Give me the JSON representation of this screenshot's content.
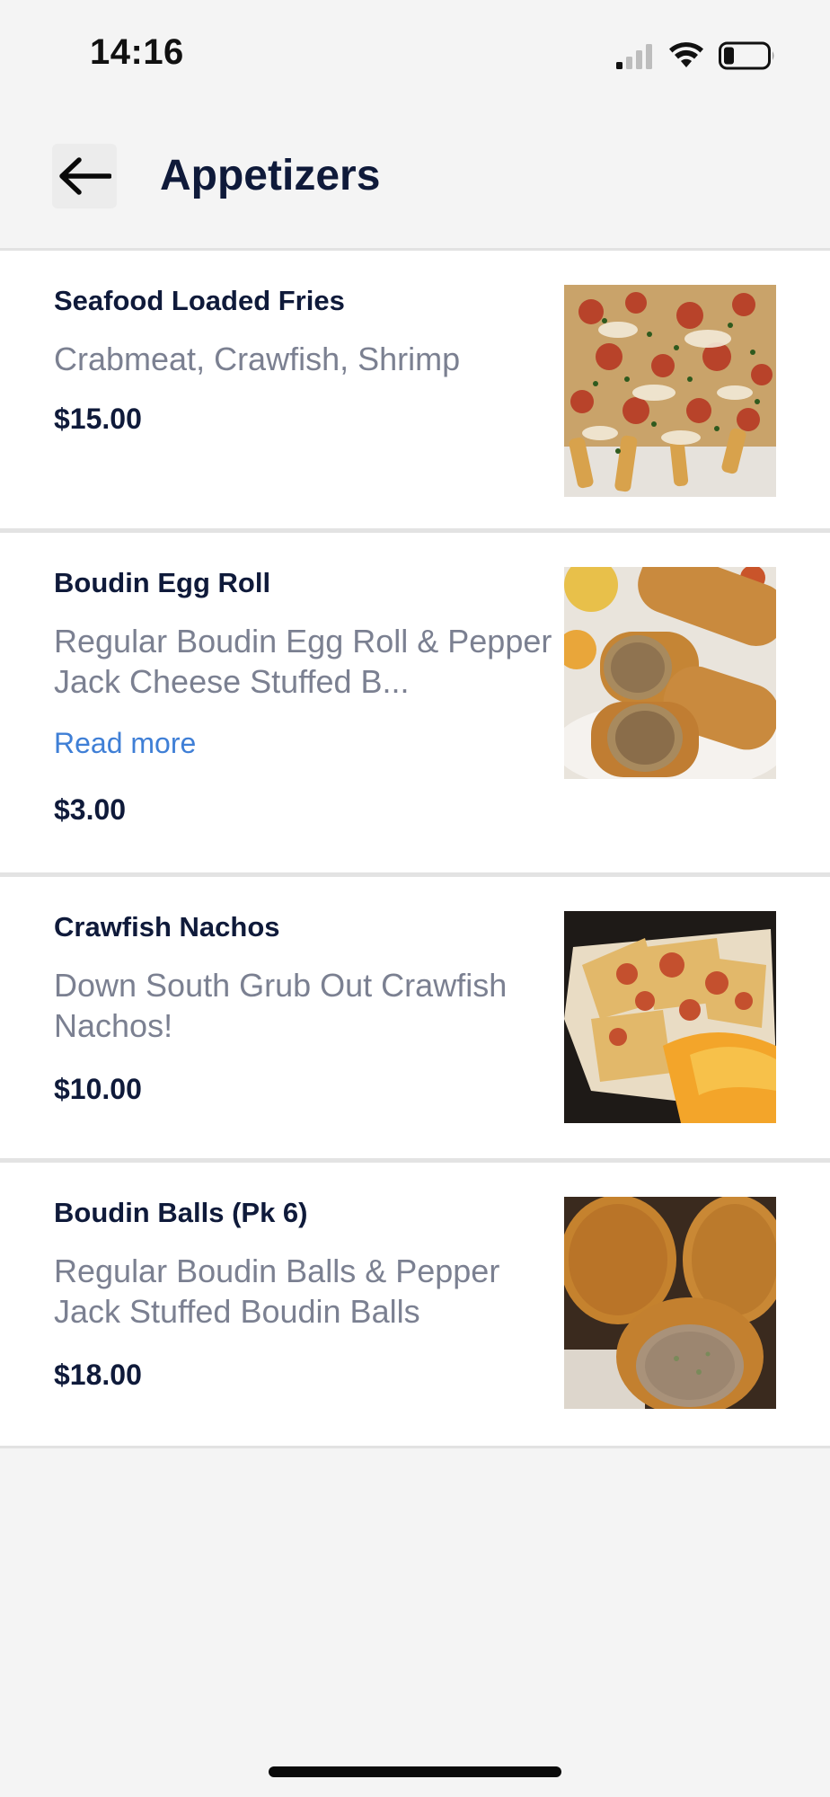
{
  "status_bar": {
    "time": "14:16",
    "icons": [
      "cellular-signal-icon",
      "wifi-icon",
      "battery-icon"
    ]
  },
  "header": {
    "back_icon": "arrow-left-icon",
    "title": "Appetizers"
  },
  "items": [
    {
      "name": "Seafood Loaded Fries",
      "description": "Crabmeat, Crawfish, Shrimp",
      "price": "$15.00",
      "image": "seafood-loaded-fries-photo"
    },
    {
      "name": "Boudin Egg Roll",
      "description": "Regular Boudin Egg Roll & Pepper Jack Cheese Stuffed B...",
      "read_more": "Read more",
      "price": "$3.00",
      "image": "boudin-egg-roll-photo"
    },
    {
      "name": "Crawfish Nachos",
      "description": "Down South Grub Out Crawfish Nachos!",
      "price": "$10.00",
      "image": "crawfish-nachos-photo"
    },
    {
      "name": "Boudin Balls (Pk 6)",
      "description": "Regular Boudin Balls & Pepper Jack Stuffed Boudin Balls",
      "price": "$18.00",
      "image": "boudin-balls-photo"
    }
  ],
  "colors": {
    "background": "#f4f4f4",
    "card": "#ffffff",
    "title": "#0f1a3a",
    "description": "#7b8091",
    "link": "#3f7fd6"
  }
}
